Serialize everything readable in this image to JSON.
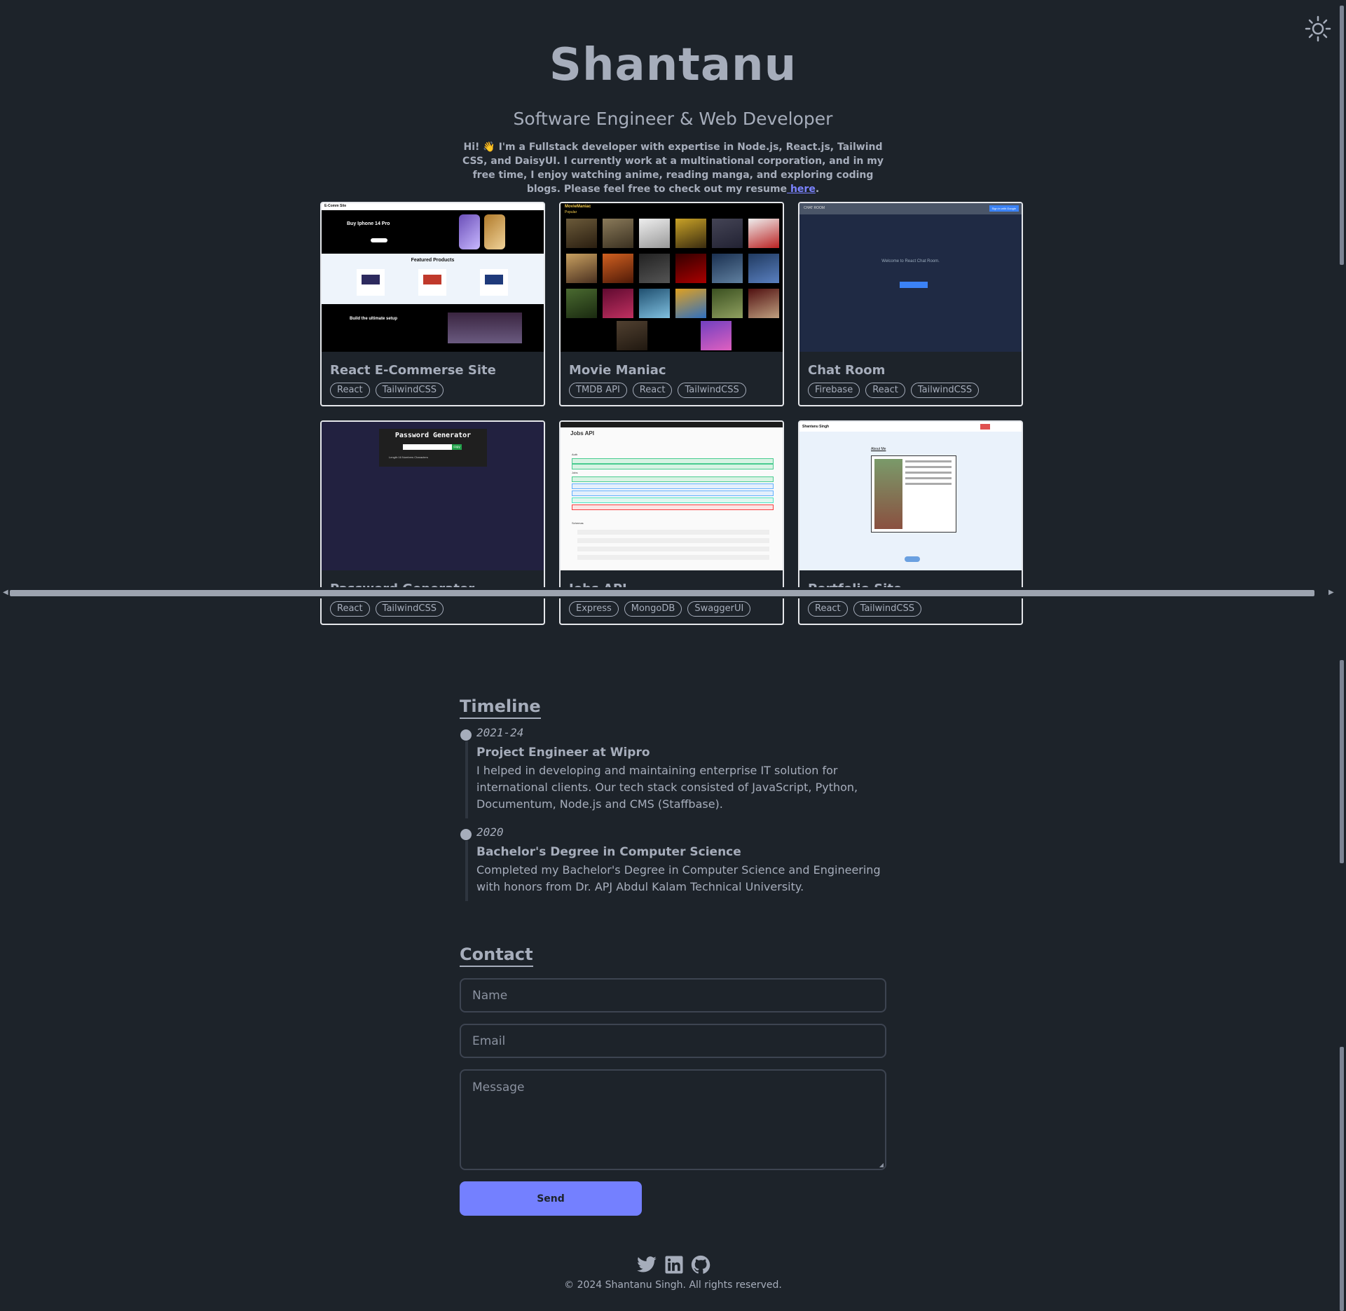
{
  "colors": {
    "background": "#1d232a",
    "text": "#a6adbb",
    "accent": "#7480ff",
    "link": "#7b83ff"
  },
  "header": {
    "theme_toggle_icon": "sun-icon"
  },
  "hero": {
    "name": "Shantanu",
    "subtitle": "Software Engineer & Web Developer",
    "intro": "Hi! 👋 I'm a Fullstack developer with expertise in Node.js, React.js, Tailwind CSS, and DaisyUI. I currently work at a multinational corporation, and in my free time, I enjoy watching anime, reading manga, and exploring coding blogs. Please feel free to check out my resume",
    "resume_link": " here",
    "intro_end": "."
  },
  "projects": [
    {
      "title": "React E-Commerse Site",
      "tags": [
        "React",
        "TailwindCSS"
      ]
    },
    {
      "title": "Movie Maniac",
      "tags": [
        "TMDB API",
        "React",
        "TailwindCSS"
      ]
    },
    {
      "title": "Chat Room",
      "tags": [
        "Firebase",
        "React",
        "TailwindCSS"
      ]
    },
    {
      "title": "Password Generator",
      "tags": [
        "React",
        "TailwindCSS"
      ]
    },
    {
      "title": "Jobs API",
      "tags": [
        "Express",
        "MongoDB",
        "SwaggerUI"
      ]
    },
    {
      "title": "Portfolio Site",
      "tags": [
        "React",
        "TailwindCSS"
      ]
    }
  ],
  "thumbnails": {
    "ecommerce": {
      "brand": "E-Comm Site",
      "hero": "Buy Iphone 14 Pro",
      "featured": "Featured Products",
      "setup": "Build the ultimate setup"
    },
    "movies": {
      "brand": "MovieManiac",
      "popular": "Popular"
    },
    "chat": {
      "brand": "CHAT ROOM",
      "signin": "Sign in with Google",
      "welcome": "Welcome to React Chat Room."
    },
    "password": {
      "heading": "Password Generator",
      "copy": "copy",
      "length": "Length:16",
      "numbers": "Numbers",
      "characters": "Characters"
    },
    "jobs": {
      "heading": "Jobs API",
      "auth": "Auth",
      "jobs": "Jobs",
      "schemas": "Schemas"
    },
    "portfolio": {
      "brand": "Shantanu Singh",
      "about": "About Me"
    }
  },
  "timeline": {
    "title": "Timeline",
    "items": [
      {
        "year": "2021-24",
        "role": "Project Engineer at Wipro",
        "description": "I helped in developing and maintaining enterprise IT solution for international clients. Our tech stack consisted of JavaScript, Python, Documentum, Node.js and CMS (Staffbase)."
      },
      {
        "year": "2020",
        "role": "Bachelor's Degree in Computer Science",
        "description": "Completed my Bachelor's Degree in Computer Science and Engineering with honors from Dr. APJ Abdul Kalam Technical University."
      }
    ]
  },
  "contact": {
    "title": "Contact",
    "name_placeholder": "Name",
    "email_placeholder": "Email",
    "message_placeholder": "Message",
    "send_label": "Send"
  },
  "footer": {
    "icons": [
      "twitter-icon",
      "linkedin-icon",
      "github-icon"
    ],
    "copyright": "© 2024 Shantanu Singh. All rights reserved."
  }
}
